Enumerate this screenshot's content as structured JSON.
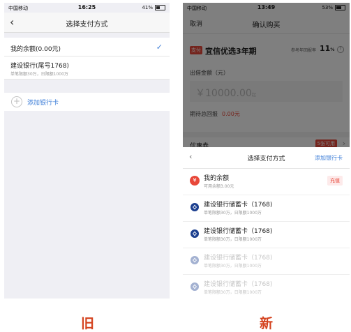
{
  "old": {
    "status": {
      "carrier": "中国移动",
      "time": "16:25",
      "battery": "41%"
    },
    "nav": {
      "back": "‹",
      "title": "选择支付方式"
    },
    "options": [
      {
        "title": "我的余额(0.00元)",
        "sub": ""
      },
      {
        "title": "建设银行(尾号1768)",
        "sub": "单笔限额30万，日限额1000万"
      }
    ],
    "checkmark": "✓",
    "add_card": "添加银行卡",
    "add_icon": "+",
    "label": "旧"
  },
  "new": {
    "status": {
      "carrier": "中国移动",
      "time": "13:49",
      "battery": "53%"
    },
    "nav": {
      "cancel": "取消",
      "title": "确认购买"
    },
    "product": {
      "tag": "支付",
      "name": "宜信优选3年期",
      "rate_label": "参考年回报率",
      "rate": "11",
      "rate_unit": "%",
      "help": "?"
    },
    "amount": {
      "label": "出借金额（元）",
      "placeholder": "￥10000.00",
      "unit": "起"
    },
    "expected": {
      "label": "期待总回报",
      "value": "0.00元"
    },
    "coupon": {
      "label": "优惠券",
      "badge": "5张可用",
      "arrow": "›"
    },
    "sheet": {
      "back": "‹",
      "title": "选择支付方式",
      "add_card": "添加银行卡",
      "balance": {
        "title": "我的余额",
        "sub": "可用余额3.00元",
        "action": "充值"
      },
      "cards": [
        {
          "title": "建设银行储蓄卡（1768)",
          "sub": "单笔限额30万，日限额1000万"
        },
        {
          "title": "建设银行储蓄卡（1768)",
          "sub": "单笔限额30万，日限额1000万"
        },
        {
          "title": "建设银行储蓄卡（1768)",
          "sub": "单笔限额30万，日限额1000万"
        },
        {
          "title": "建设银行储蓄卡（1768)",
          "sub": "单笔限额30万，日限额1000万"
        }
      ]
    },
    "label": "新"
  },
  "colors": {
    "accent": "#3f7fd8",
    "red": "#e8483a",
    "ccb": "#1c3f8f"
  },
  "icons": {
    "bank": "ccb-bank-icon",
    "balance": "wallet-icon"
  }
}
